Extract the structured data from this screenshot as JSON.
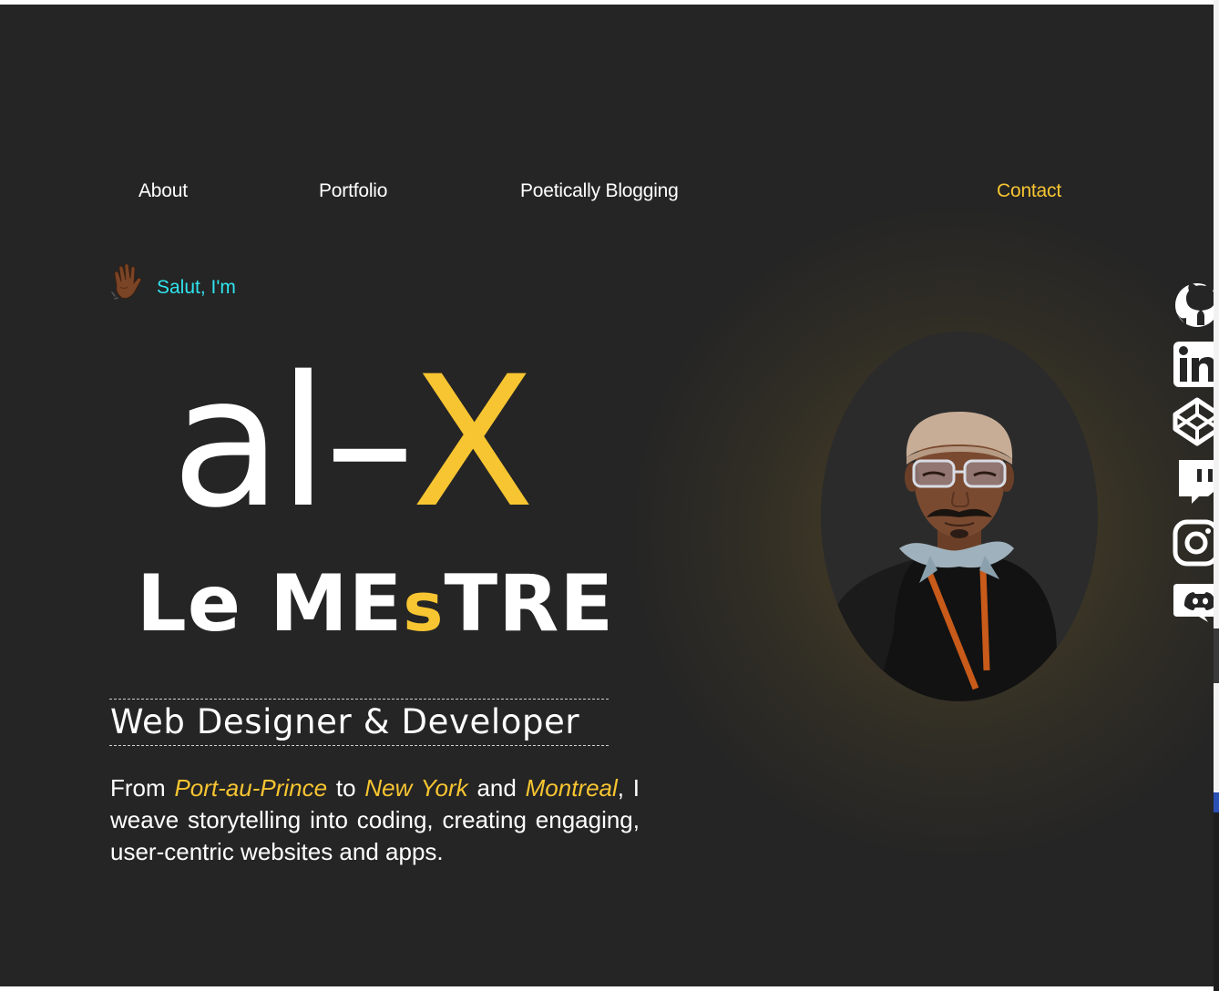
{
  "nav": {
    "about": "About",
    "portfolio": "Portfolio",
    "blog": "Poetically Blogging",
    "contact": "Contact"
  },
  "hero": {
    "greeting": "Salut, I'm",
    "wave_icon": "waving-hand-icon",
    "name_first": "al–",
    "name_accent": "X",
    "title_prefix": "Le ME",
    "title_accent": "s",
    "title_suffix": "TRE",
    "role": "Web Designer & Developer",
    "bio": {
      "from": "From",
      "city1": "Port-au-Prince",
      "to": "to",
      "city2": "New York",
      "and": "and",
      "city3": "Montreal",
      "rest": ", I weave storytelling into coding, creating engaging, user-centric websites and apps."
    }
  },
  "social_icons": [
    "github-icon",
    "linkedin-icon",
    "codepen-icon",
    "twitch-icon",
    "instagram-icon",
    "discord-icon"
  ],
  "colors": {
    "background": "#252525",
    "accent": "#f7c531",
    "greeting": "#2fe4ee",
    "text": "#ffffff"
  }
}
